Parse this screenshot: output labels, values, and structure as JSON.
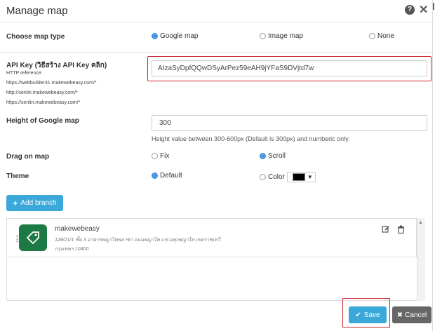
{
  "dialog": {
    "title": "Manage map"
  },
  "map_type": {
    "label": "Choose map type",
    "options": [
      "Google map",
      "Image map",
      "None"
    ],
    "selected": "Google map"
  },
  "api_key": {
    "label": "API Key (วิธีสร้าง API Key คลิก)",
    "value": "AIzaSyDpfQQwDSyArPez59eAH9jYFaS9DVjtd7w",
    "http_reference_label": "HTTP reference:",
    "references": [
      "https://webbuilder31.makewebeasy.com/*",
      "http://senlin.makewebeasy.com/*",
      "https://senlin.makewebeasy.com/*"
    ]
  },
  "height": {
    "label": "Height of Google map",
    "value": "300",
    "hint": "Height value between 300-600px (Default is 300px) and numberic only."
  },
  "drag": {
    "label": "Drag on map",
    "options": [
      "Fix",
      "Scroll"
    ],
    "selected": "Scroll"
  },
  "theme": {
    "label": "Theme",
    "options": [
      "Default",
      "Color"
    ],
    "selected": "Default",
    "color_value": "#000000"
  },
  "add_branch_label": "Add branch",
  "branches": [
    {
      "name": "makewebeasy",
      "address": "128/21/1 ชั้น 3 อาคารพญาไทพลาซ่า ถนนพญาไท แขวงทุ่งพญาไท เขตราชเทวี",
      "city": "กรุงเทพฯ 10400"
    }
  ],
  "footer": {
    "save_label": "Save",
    "cancel_label": "Cancel"
  },
  "colors": {
    "accent": "#3aa9d9",
    "highlight": "#c8242c",
    "logo_bg": "#1e7a45",
    "cancel_bg": "#666666"
  }
}
